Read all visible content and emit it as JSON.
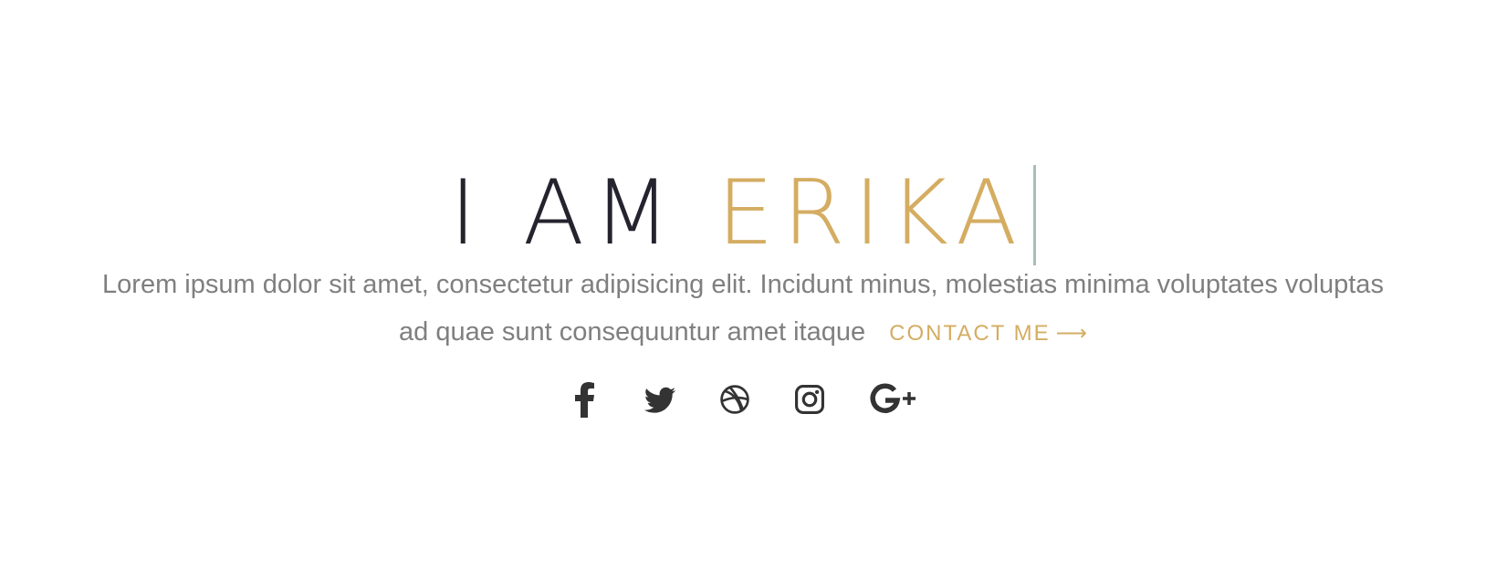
{
  "hero": {
    "headline_prefix": "I AM ",
    "headline_name": "ERIKA",
    "intro": "Lorem ipsum dolor sit amet, consectetur adipisicing elit. Incidunt minus, molestias minima voluptates voluptas ad quae sunt consequuntur amet itaque",
    "contact_label": "CONTACT ME",
    "contact_arrow": "⟶"
  },
  "social": [
    {
      "icon": "facebook-icon"
    },
    {
      "icon": "twitter-icon"
    },
    {
      "icon": "dribbble-icon"
    },
    {
      "icon": "instagram-icon"
    },
    {
      "icon": "google-plus-icon"
    }
  ],
  "colors": {
    "text_dark": "#24232e",
    "accent": "#d4ad62",
    "body_text": "#7f7f7f",
    "cursor": "#a9bdb6",
    "icon": "#333333"
  }
}
